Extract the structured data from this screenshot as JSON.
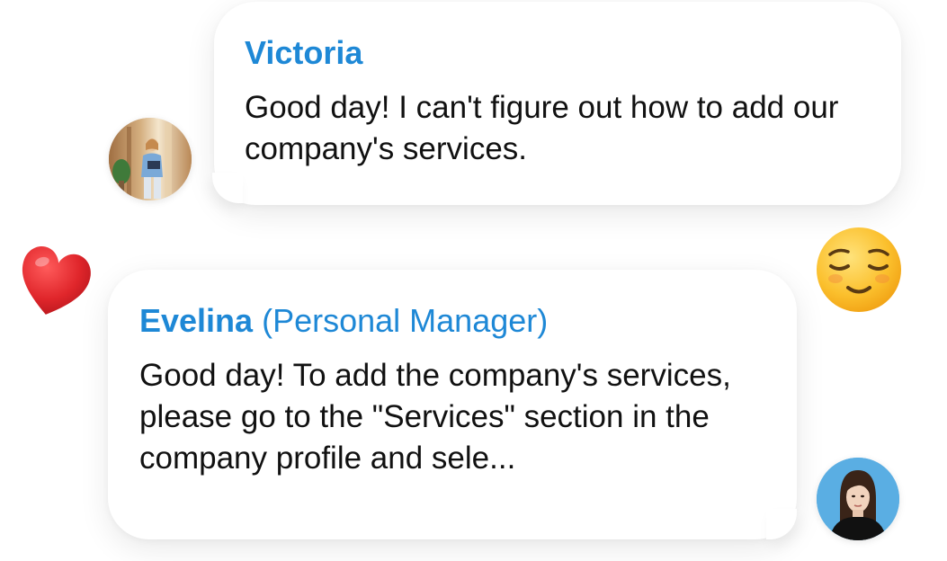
{
  "chat": {
    "messages": [
      {
        "sender": "Victoria",
        "text": "Good day! I can't figure out how to add our company's services."
      },
      {
        "sender": "Evelina",
        "role": "(Personal Manager)",
        "text": "Good day! To add the company's services, please go to the \"Services\" section in the company profile and sele..."
      }
    ]
  },
  "icons": {
    "heart": "heart-emoji",
    "relieved_face": "relieved-face-emoji"
  },
  "colors": {
    "sender_name": "#1e88d6",
    "message_text": "#111111",
    "bubble": "#ffffff",
    "heart": "#e0262b",
    "emoji_face": "#f7b51c"
  }
}
